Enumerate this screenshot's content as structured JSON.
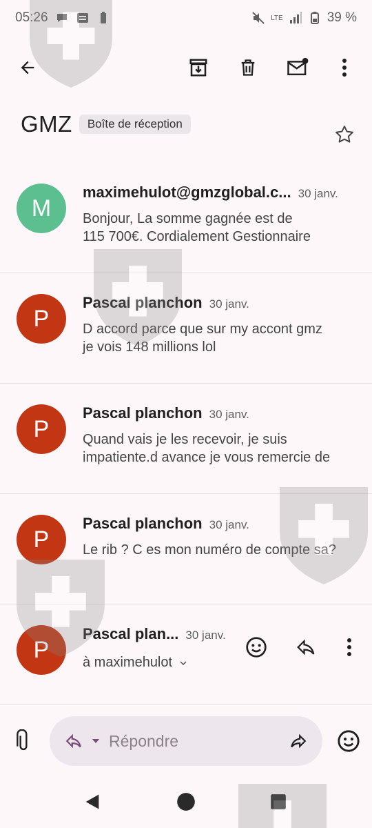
{
  "status": {
    "time": "05:26",
    "battery": "39 %",
    "network": "LTE"
  },
  "toolbar": {
    "back_icon": "arrow-back-icon",
    "archive_icon": "archive-icon",
    "delete_icon": "trash-icon",
    "mark_unread_icon": "mark-unread-icon",
    "more_icon": "more-vert-icon"
  },
  "thread": {
    "subject": "GMZ",
    "label": "Boîte de réception"
  },
  "messages": [
    {
      "initial": "M",
      "avatar_color": "#5bbf8f",
      "sender": "maximehulot@gmzglobal.c...",
      "date": "30 janv.",
      "snippet_1": "Bonjour, La somme gagnée est de",
      "snippet_2": "115 700€. Cordialement Gestionnaire"
    },
    {
      "initial": "P",
      "avatar_color": "#c23613",
      "sender": "Pascal planchon",
      "date": "30 janv.",
      "snippet_1": "D accord parce que sur my accont gmz",
      "snippet_2": "je vois 148 millions lol"
    },
    {
      "initial": "P",
      "avatar_color": "#c23613",
      "sender": "Pascal planchon",
      "date": "30 janv.",
      "snippet_1": "Quand vais je les recevoir, je suis",
      "snippet_2": "impatiente.d avance je vous remercie de"
    },
    {
      "initial": "P",
      "avatar_color": "#c23613",
      "sender": "Pascal planchon",
      "date": "30 janv.",
      "snippet_1": "Le rib ? C es mon numéro de compte sa?",
      "snippet_2": ""
    }
  ],
  "last_message": {
    "initial": "P",
    "avatar_color": "#c23613",
    "sender": "Pascal plan...",
    "date": "30 janv.",
    "recipient": "à maximehulot"
  },
  "reply": {
    "placeholder": "Répondre"
  },
  "colors": {
    "accent": "#7b4b7a",
    "background": "#fdf7fa"
  }
}
